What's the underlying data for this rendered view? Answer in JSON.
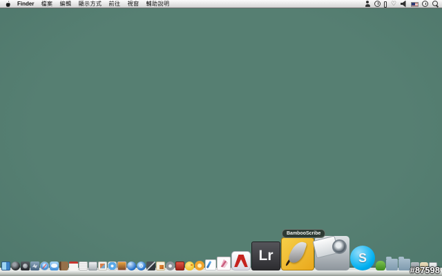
{
  "menu_bar": {
    "app_name": "Finder",
    "menus": [
      "檔案",
      "編輯",
      "顯示方式",
      "前往",
      "視窗",
      "輔助說明"
    ],
    "status_icons": [
      "user",
      "time-machine",
      "battery",
      "heart",
      "volume",
      "input-flag-us",
      "clock",
      "spotlight"
    ]
  },
  "desktop": {
    "background_color": "#547f72"
  },
  "dock": {
    "tooltip": "BambooScribe",
    "icons": [
      {
        "name": "finder",
        "size": 13
      },
      {
        "name": "dashboard",
        "size": 13
      },
      {
        "name": "photo-booth",
        "size": 13
      },
      {
        "name": "mail",
        "size": 13
      },
      {
        "name": "safari",
        "size": 13
      },
      {
        "name": "ichat",
        "size": 13
      },
      {
        "name": "address-book",
        "size": 13
      },
      {
        "name": "ical",
        "size": 13
      },
      {
        "name": "textedit",
        "size": 13
      },
      {
        "name": "calculator",
        "size": 13
      },
      {
        "name": "preview",
        "size": 13
      },
      {
        "name": "itunes",
        "size": 13
      },
      {
        "name": "iphoto",
        "size": 13
      },
      {
        "name": "blue-sphere",
        "size": 13
      },
      {
        "name": "quicktime",
        "size": 13
      },
      {
        "name": "ink-pen",
        "size": 13
      },
      {
        "name": "image-editor",
        "size": 13
      },
      {
        "name": "grey-disc",
        "size": 13
      },
      {
        "name": "red-app",
        "size": 13
      },
      {
        "name": "cyberduck",
        "size": 13
      },
      {
        "name": "flower-app",
        "size": 14
      },
      {
        "name": "paint-app",
        "size": 16
      },
      {
        "name": "pink-fan-app",
        "size": 20
      },
      {
        "name": "adobe-reader",
        "size": 28
      },
      {
        "name": "lightroom",
        "size": 42,
        "label": "Lr"
      },
      {
        "name": "bamboo-scribe",
        "size": 48
      },
      {
        "name": "image-capture",
        "size": 50
      },
      {
        "name": "skype",
        "size": 36,
        "label": "S"
      },
      {
        "name": "green-figure",
        "size": 14
      },
      {
        "name": "folder",
        "size": 17
      },
      {
        "name": "folder",
        "size": 17
      },
      {
        "name": "appliance-grey",
        "size": 12
      },
      {
        "name": "appliance-beige",
        "size": 12
      },
      {
        "name": "trash",
        "size": 12
      }
    ]
  },
  "watermark": "#87598",
  "colors": {
    "desktop": "#547f72",
    "skype_blue": "#00aff0",
    "bamboo_yellow": "#eeb426",
    "lightroom_grey": "#3a3a3c"
  }
}
